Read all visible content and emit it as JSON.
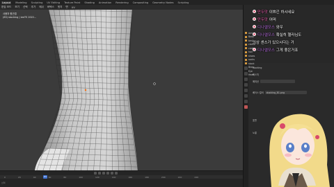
{
  "topbar": {
    "workspaces": [
      "Layout",
      "Modeling",
      "Sculpting",
      "UV Editing",
      "Texture Paint",
      "Shading",
      "Animation",
      "Rendering",
      "Compositing",
      "Geometry Nodes",
      "Scripting"
    ],
    "active": "Layout"
  },
  "toolbar": {
    "mode": "편집 모드",
    "items": [
      "보기",
      "선택",
      "추가",
      "메쉬",
      "버텍스",
      "엣지",
      "면",
      "UV"
    ]
  },
  "viewport": {
    "info_line1": "사용자 원근법",
    "info_line2": "(83) stocking | bmTS 2022..."
  },
  "timeline": {
    "current_frame": "83",
    "ticks": [
      "0",
      "20",
      "40",
      "60",
      "80",
      "100",
      "120",
      "140",
      "160",
      "180",
      "200",
      "220",
      "240"
    ],
    "status": "선택"
  },
  "outliner": {
    "rows": [
      "Armat",
      "Body",
      "bmA",
      "clothe",
      "clothe",
      "hair",
      "shoes",
      "socks",
      "stock",
      "Brow",
      "Eye",
      "Head"
    ]
  },
  "properties": {
    "header": "stocking",
    "lines": [
      "텍스처",
      "에미션",
      "베이스 컬러",
      "표면",
      "노멀",
      "stocking_B1.png"
    ],
    "field_image": "stocking_B1.png"
  },
  "chat": {
    "messages": [
      {
        "name": "만두맛",
        "text": "이쁘긴 하시네요",
        "name_color": "pink"
      },
      {
        "name": "만두맛",
        "text": "어머",
        "name_color": "pink"
      },
      {
        "name": "디나엘모스",
        "text": "와우",
        "name_color": "purple"
      },
      {
        "name": "디나엘모스",
        "text": "확실히 헬라님도",
        "name_color": "purple"
      },
      {
        "name": "",
        "text": "의상 센스가 있으시다는 거",
        "name_color": "purple"
      },
      {
        "name": "디나엘모스",
        "text": "그게 좋은거죠",
        "name_color": "purple"
      }
    ]
  },
  "colors": {
    "accent_blue": "#3c6fcf",
    "chat_name_pink": "#e35aa8",
    "chat_name_purple": "#b06bd6"
  }
}
